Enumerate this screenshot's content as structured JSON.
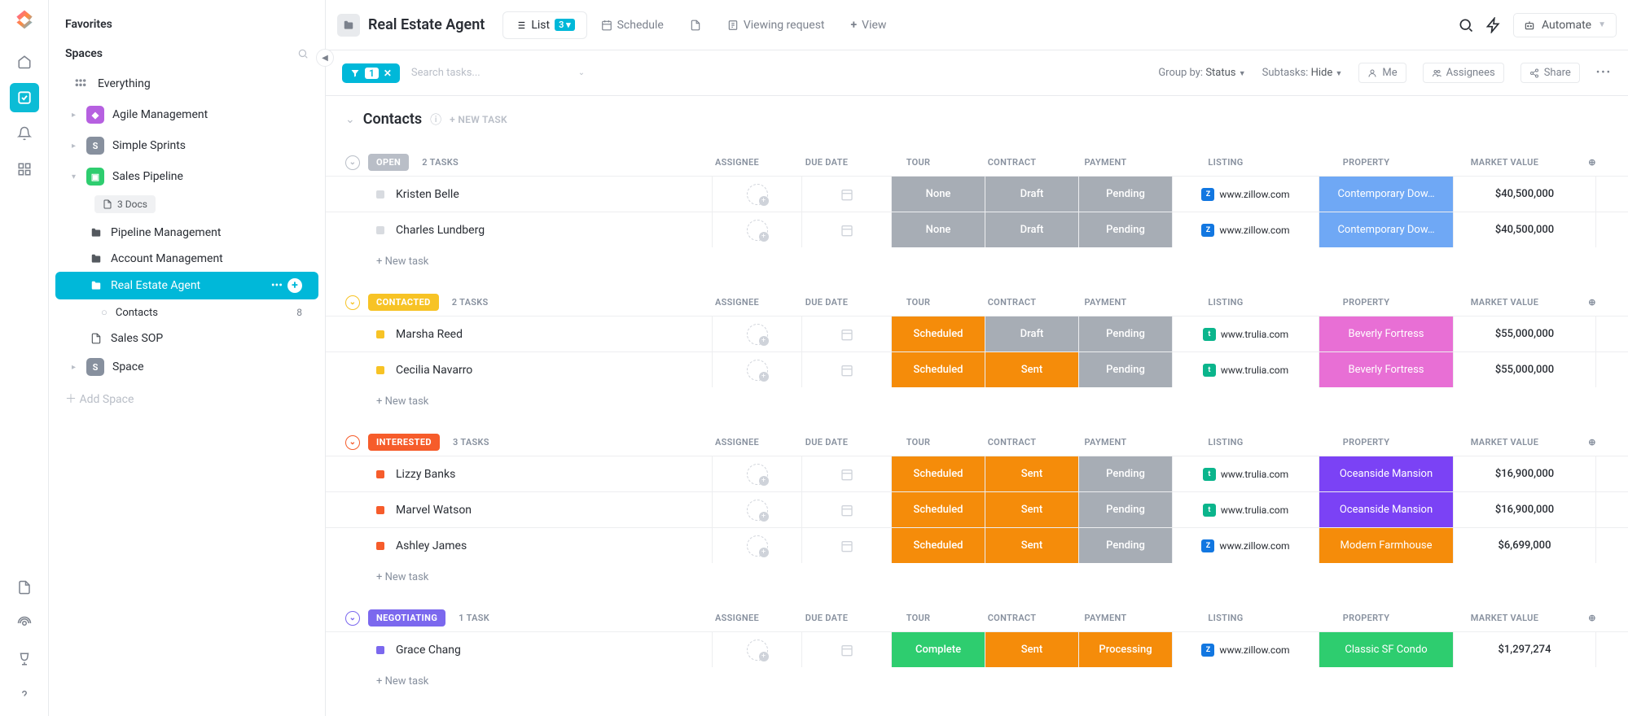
{
  "rail": {
    "items": [
      "home",
      "tasks",
      "notifications",
      "dashboards"
    ],
    "bottom": [
      "docs",
      "pulse",
      "goals",
      "help"
    ]
  },
  "sidebar": {
    "favorites": "Favorites",
    "spaces": "Spaces",
    "everything": "Everything",
    "items": [
      {
        "label": "Agile Management",
        "color": "#b660e0",
        "initial": "◆"
      },
      {
        "label": "Simple Sprints",
        "color": "#87909e",
        "initial": "S"
      },
      {
        "label": "Sales Pipeline",
        "color": "#2ecd6f",
        "initial": "▣",
        "expanded": true,
        "docs": "3 Docs",
        "children": [
          {
            "label": "Pipeline Management",
            "icon": "folder"
          },
          {
            "label": "Account Management",
            "icon": "folder"
          },
          {
            "label": "Real Estate Agent",
            "icon": "folder",
            "selected": true,
            "children": [
              {
                "label": "Contacts",
                "count": "8"
              }
            ]
          },
          {
            "label": "Sales SOP",
            "icon": "doc"
          }
        ]
      },
      {
        "label": "Space",
        "color": "#87909e",
        "initial": "S"
      }
    ],
    "add": "Add Space"
  },
  "topbar": {
    "title": "Real Estate Agent",
    "views": [
      {
        "label": "List",
        "badge": "3 ▾",
        "active": true,
        "icon": "list"
      },
      {
        "label": "Schedule",
        "icon": "calendar"
      },
      {
        "label": "",
        "icon": "doc"
      },
      {
        "label": "Viewing request",
        "icon": "form"
      },
      {
        "label": "View",
        "icon": "plus"
      }
    ],
    "automate": "Automate"
  },
  "toolbar": {
    "filter_count": "1",
    "search_ph": "Search tasks...",
    "groupby_label": "Group by:",
    "groupby_value": "Status",
    "subtasks_label": "Subtasks:",
    "subtasks_value": "Hide",
    "me": "Me",
    "assignees": "Assignees",
    "share": "Share"
  },
  "list": {
    "title": "Contacts",
    "new_task": "+ NEW TASK"
  },
  "columns": [
    "ASSIGNEE",
    "DUE DATE",
    "TOUR",
    "CONTRACT",
    "PAYMENT",
    "LISTING",
    "PROPERTY",
    "MARKET VALUE"
  ],
  "col_widths": {
    "ass": 110,
    "due": 110,
    "tag": 115,
    "list": 180,
    "prop": 165,
    "val": 175,
    "plus": 40
  },
  "colors": {
    "open": "#b9bec7",
    "contacted": "#f7c325",
    "interested": "#f65c2b",
    "negotiating": "#7b68ee",
    "none": "#a7adb5",
    "scheduled": "#f58c0a",
    "complete": "#2ecd6f",
    "draft": "#a7adb5",
    "sent": "#f58c0a",
    "pending": "#a7adb5",
    "processing": "#f58c0a",
    "zillow": "#1277e1",
    "trulia": "#0bb58c",
    "prop_blue": "#6fa8f5",
    "prop_pink": "#e86fd5",
    "prop_purple": "#7b42f5",
    "prop_orange": "#f58c0a",
    "prop_green": "#2ecd6f"
  },
  "groups": [
    {
      "status": "OPEN",
      "status_color": "open",
      "count": "2 TASKS",
      "ring": "#b9bec7",
      "rows": [
        {
          "name": "Kristen Belle",
          "dot": "#d8dbe0",
          "tour": "None",
          "tour_c": "none",
          "contract": "Draft",
          "contract_c": "draft",
          "payment": "Pending",
          "payment_c": "pending",
          "listing": "www.zillow.com",
          "listing_c": "zillow",
          "property": "Contemporary Dow…",
          "property_c": "prop_blue",
          "value": "$40,500,000"
        },
        {
          "name": "Charles Lundberg",
          "dot": "#d8dbe0",
          "tour": "None",
          "tour_c": "none",
          "contract": "Draft",
          "contract_c": "draft",
          "payment": "Pending",
          "payment_c": "pending",
          "listing": "www.zillow.com",
          "listing_c": "zillow",
          "property": "Contemporary Dow…",
          "property_c": "prop_blue",
          "value": "$40,500,000"
        }
      ]
    },
    {
      "status": "CONTACTED",
      "status_color": "contacted",
      "count": "2 TASKS",
      "ring": "#f7c325",
      "rows": [
        {
          "name": "Marsha Reed",
          "dot": "#f7c325",
          "tour": "Scheduled",
          "tour_c": "scheduled",
          "contract": "Draft",
          "contract_c": "draft",
          "payment": "Pending",
          "payment_c": "pending",
          "listing": "www.trulia.com",
          "listing_c": "trulia",
          "property": "Beverly Fortress",
          "property_c": "prop_pink",
          "value": "$55,000,000"
        },
        {
          "name": "Cecilia Navarro",
          "dot": "#f7c325",
          "tour": "Scheduled",
          "tour_c": "scheduled",
          "contract": "Sent",
          "contract_c": "sent",
          "payment": "Pending",
          "payment_c": "pending",
          "listing": "www.trulia.com",
          "listing_c": "trulia",
          "property": "Beverly Fortress",
          "property_c": "prop_pink",
          "value": "$55,000,000"
        }
      ]
    },
    {
      "status": "INTERESTED",
      "status_color": "interested",
      "count": "3 TASKS",
      "ring": "#f65c2b",
      "rows": [
        {
          "name": "Lizzy Banks",
          "dot": "#f65c2b",
          "tour": "Scheduled",
          "tour_c": "scheduled",
          "contract": "Sent",
          "contract_c": "sent",
          "payment": "Pending",
          "payment_c": "pending",
          "listing": "www.trulia.com",
          "listing_c": "trulia",
          "property": "Oceanside Mansion",
          "property_c": "prop_purple",
          "value": "$16,900,000"
        },
        {
          "name": "Marvel Watson",
          "dot": "#f65c2b",
          "tour": "Scheduled",
          "tour_c": "scheduled",
          "contract": "Sent",
          "contract_c": "sent",
          "payment": "Pending",
          "payment_c": "pending",
          "listing": "www.trulia.com",
          "listing_c": "trulia",
          "property": "Oceanside Mansion",
          "property_c": "prop_purple",
          "value": "$16,900,000"
        },
        {
          "name": "Ashley James",
          "dot": "#f65c2b",
          "tour": "Scheduled",
          "tour_c": "scheduled",
          "contract": "Sent",
          "contract_c": "sent",
          "payment": "Pending",
          "payment_c": "pending",
          "listing": "www.zillow.com",
          "listing_c": "zillow",
          "property": "Modern Farmhouse",
          "property_c": "prop_orange",
          "value": "$6,699,000"
        }
      ]
    },
    {
      "status": "NEGOTIATING",
      "status_color": "negotiating",
      "count": "1 TASK",
      "ring": "#7b68ee",
      "rows": [
        {
          "name": "Grace Chang",
          "dot": "#7b68ee",
          "tour": "Complete",
          "tour_c": "complete",
          "contract": "Sent",
          "contract_c": "sent",
          "payment": "Processing",
          "payment_c": "processing",
          "listing": "www.zillow.com",
          "listing_c": "zillow",
          "property": "Classic SF Condo",
          "property_c": "prop_green",
          "value": "$1,297,274"
        }
      ]
    }
  ],
  "new_task_row": "+ New task"
}
